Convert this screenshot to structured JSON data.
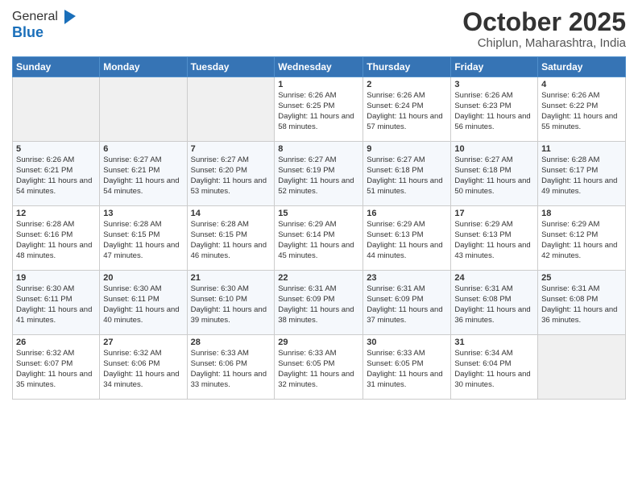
{
  "header": {
    "logo_line1": "General",
    "logo_line2": "Blue",
    "month": "October 2025",
    "location": "Chiplun, Maharashtra, India"
  },
  "weekdays": [
    "Sunday",
    "Monday",
    "Tuesday",
    "Wednesday",
    "Thursday",
    "Friday",
    "Saturday"
  ],
  "weeks": [
    [
      {
        "day": "",
        "empty": true
      },
      {
        "day": "",
        "empty": true
      },
      {
        "day": "",
        "empty": true
      },
      {
        "day": "1",
        "sunrise": "6:26 AM",
        "sunset": "6:25 PM",
        "daylight": "11 hours and 58 minutes."
      },
      {
        "day": "2",
        "sunrise": "6:26 AM",
        "sunset": "6:24 PM",
        "daylight": "11 hours and 57 minutes."
      },
      {
        "day": "3",
        "sunrise": "6:26 AM",
        "sunset": "6:23 PM",
        "daylight": "11 hours and 56 minutes."
      },
      {
        "day": "4",
        "sunrise": "6:26 AM",
        "sunset": "6:22 PM",
        "daylight": "11 hours and 55 minutes."
      }
    ],
    [
      {
        "day": "5",
        "sunrise": "6:26 AM",
        "sunset": "6:21 PM",
        "daylight": "11 hours and 54 minutes."
      },
      {
        "day": "6",
        "sunrise": "6:27 AM",
        "sunset": "6:21 PM",
        "daylight": "11 hours and 54 minutes."
      },
      {
        "day": "7",
        "sunrise": "6:27 AM",
        "sunset": "6:20 PM",
        "daylight": "11 hours and 53 minutes."
      },
      {
        "day": "8",
        "sunrise": "6:27 AM",
        "sunset": "6:19 PM",
        "daylight": "11 hours and 52 minutes."
      },
      {
        "day": "9",
        "sunrise": "6:27 AM",
        "sunset": "6:18 PM",
        "daylight": "11 hours and 51 minutes."
      },
      {
        "day": "10",
        "sunrise": "6:27 AM",
        "sunset": "6:18 PM",
        "daylight": "11 hours and 50 minutes."
      },
      {
        "day": "11",
        "sunrise": "6:28 AM",
        "sunset": "6:17 PM",
        "daylight": "11 hours and 49 minutes."
      }
    ],
    [
      {
        "day": "12",
        "sunrise": "6:28 AM",
        "sunset": "6:16 PM",
        "daylight": "11 hours and 48 minutes."
      },
      {
        "day": "13",
        "sunrise": "6:28 AM",
        "sunset": "6:15 PM",
        "daylight": "11 hours and 47 minutes."
      },
      {
        "day": "14",
        "sunrise": "6:28 AM",
        "sunset": "6:15 PM",
        "daylight": "11 hours and 46 minutes."
      },
      {
        "day": "15",
        "sunrise": "6:29 AM",
        "sunset": "6:14 PM",
        "daylight": "11 hours and 45 minutes."
      },
      {
        "day": "16",
        "sunrise": "6:29 AM",
        "sunset": "6:13 PM",
        "daylight": "11 hours and 44 minutes."
      },
      {
        "day": "17",
        "sunrise": "6:29 AM",
        "sunset": "6:13 PM",
        "daylight": "11 hours and 43 minutes."
      },
      {
        "day": "18",
        "sunrise": "6:29 AM",
        "sunset": "6:12 PM",
        "daylight": "11 hours and 42 minutes."
      }
    ],
    [
      {
        "day": "19",
        "sunrise": "6:30 AM",
        "sunset": "6:11 PM",
        "daylight": "11 hours and 41 minutes."
      },
      {
        "day": "20",
        "sunrise": "6:30 AM",
        "sunset": "6:11 PM",
        "daylight": "11 hours and 40 minutes."
      },
      {
        "day": "21",
        "sunrise": "6:30 AM",
        "sunset": "6:10 PM",
        "daylight": "11 hours and 39 minutes."
      },
      {
        "day": "22",
        "sunrise": "6:31 AM",
        "sunset": "6:09 PM",
        "daylight": "11 hours and 38 minutes."
      },
      {
        "day": "23",
        "sunrise": "6:31 AM",
        "sunset": "6:09 PM",
        "daylight": "11 hours and 37 minutes."
      },
      {
        "day": "24",
        "sunrise": "6:31 AM",
        "sunset": "6:08 PM",
        "daylight": "11 hours and 36 minutes."
      },
      {
        "day": "25",
        "sunrise": "6:31 AM",
        "sunset": "6:08 PM",
        "daylight": "11 hours and 36 minutes."
      }
    ],
    [
      {
        "day": "26",
        "sunrise": "6:32 AM",
        "sunset": "6:07 PM",
        "daylight": "11 hours and 35 minutes."
      },
      {
        "day": "27",
        "sunrise": "6:32 AM",
        "sunset": "6:06 PM",
        "daylight": "11 hours and 34 minutes."
      },
      {
        "day": "28",
        "sunrise": "6:33 AM",
        "sunset": "6:06 PM",
        "daylight": "11 hours and 33 minutes."
      },
      {
        "day": "29",
        "sunrise": "6:33 AM",
        "sunset": "6:05 PM",
        "daylight": "11 hours and 32 minutes."
      },
      {
        "day": "30",
        "sunrise": "6:33 AM",
        "sunset": "6:05 PM",
        "daylight": "11 hours and 31 minutes."
      },
      {
        "day": "31",
        "sunrise": "6:34 AM",
        "sunset": "6:04 PM",
        "daylight": "11 hours and 30 minutes."
      },
      {
        "day": "",
        "empty": true
      }
    ]
  ],
  "labels": {
    "sunrise": "Sunrise:",
    "sunset": "Sunset:",
    "daylight": "Daylight:"
  }
}
